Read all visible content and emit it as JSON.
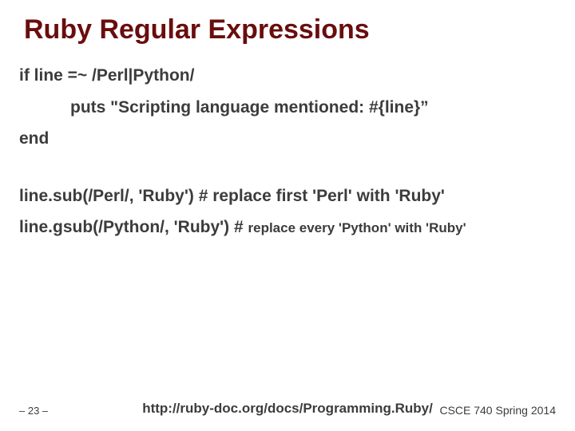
{
  "title": "Ruby Regular Expressions",
  "lines": {
    "l1": "if line =~ /Perl|Python/",
    "l2": "puts \"Scripting language mentioned: #{line}”",
    "l3": "end",
    "l4_code": "line.sub(/Perl/, 'Ruby')",
    "l4_cmt": "   # replace first 'Perl' with 'Ruby'",
    "l5_code": "line.gsub(/Python/, 'Ruby') # ",
    "l5_cmt": "replace every 'Python' with 'Ruby'"
  },
  "footer": {
    "left": "– 23 –",
    "center": "http://ruby-doc.org/docs/Programming.Ruby/",
    "right": "CSCE 740 Spring 2014"
  }
}
